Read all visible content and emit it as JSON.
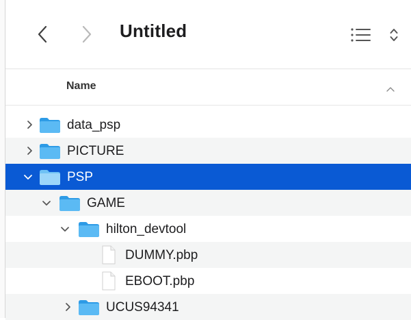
{
  "toolbar": {
    "back_icon": "chevron-left-icon",
    "forward_icon": "chevron-right-icon",
    "title": "Untitled",
    "view_icon": "list-view-icon",
    "sort_icon": "up-down-chevron-icon"
  },
  "columns": {
    "name": "Name",
    "sort_direction": "ascending"
  },
  "rows": [
    {
      "label": "data_psp",
      "type": "folder",
      "expanded": false
    },
    {
      "label": "PICTURE",
      "type": "folder",
      "expanded": false
    },
    {
      "label": "PSP",
      "type": "folder",
      "expanded": true,
      "selected": true
    },
    {
      "label": "GAME",
      "type": "folder",
      "expanded": true
    },
    {
      "label": "hilton_devtool",
      "type": "folder",
      "expanded": true
    },
    {
      "label": "DUMMY.pbp",
      "type": "file"
    },
    {
      "label": "EBOOT.pbp",
      "type": "file"
    },
    {
      "label": "UCUS94341",
      "type": "folder",
      "expanded": false
    }
  ],
  "colors": {
    "selection": "#0a5ad4",
    "folder": "#3aa9ee"
  }
}
